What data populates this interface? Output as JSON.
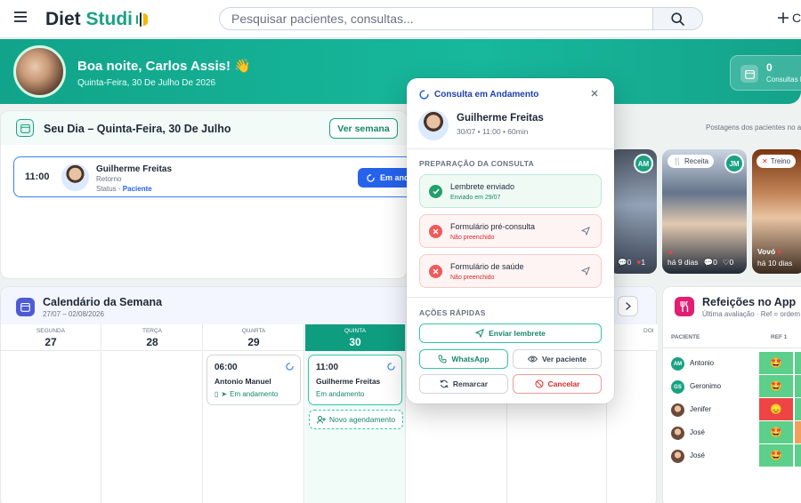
{
  "header": {
    "logo_main": "Diet ",
    "logo_accent": "Studi",
    "search_placeholder": "Pesquisar pacientes, consultas...",
    "plus_label": "C"
  },
  "hero": {
    "greeting": "Boa noite, Carlos Assis!",
    "wave": "👋",
    "date": "Quinta-Feira, 30 De Julho De 2026",
    "stat_value": "0",
    "stat_label": "Consultas H"
  },
  "day": {
    "title": "Seu Dia – Quinta-Feira, 30 De Julho",
    "week_button": "Ver semana",
    "appointment": {
      "time": "11:00",
      "name": "Guilherme Freitas",
      "type": "Retorno",
      "status_label": "Status - ",
      "status_value": "Paciente",
      "enter_button": "Em and"
    }
  },
  "posts": {
    "label": "Postagens dos pacientes no a",
    "stories": [
      {
        "badge": "",
        "avatar": "AM",
        "comments": "0",
        "likes": "1",
        "caption": "",
        "time": ""
      },
      {
        "badge": "Receita",
        "avatar": "JM",
        "comments": "0",
        "likes": "0",
        "caption": "",
        "time": "há 9 dias"
      },
      {
        "badge": "Treino",
        "avatar": "",
        "comments": "",
        "likes": "",
        "caption": "Vovó",
        "time": "há 10 dias"
      }
    ]
  },
  "calendar": {
    "title": "Calendário da Semana",
    "range": "27/07 – 02/08/2026",
    "days": [
      {
        "name": "SEGUNDA",
        "num": "27"
      },
      {
        "name": "TERÇA",
        "num": "28"
      },
      {
        "name": "QUARTA",
        "num": "29"
      },
      {
        "name": "QUINTA",
        "num": "30"
      },
      {
        "name": "",
        "num": ""
      },
      {
        "name": "",
        "num": ""
      },
      {
        "name": "DOI",
        "num": ""
      }
    ],
    "events": [
      {
        "time": "06:00",
        "name": "Antonio Manuel",
        "status": "Em andamento"
      },
      {
        "time": "11:00",
        "name": "Guilherme Freitas",
        "status": "Em andamento"
      }
    ],
    "new_appointment": "Novo agendamento"
  },
  "meals": {
    "title": "Refeições no App",
    "subtitle": "Última avaliação · Ref = ordem",
    "col_patient": "PACIENTE",
    "col_ref": "REF 1",
    "rows": [
      {
        "initials": "AM",
        "name": "Antonio",
        "emoji": "🤩",
        "color": "#5ccf8a"
      },
      {
        "initials": "GS",
        "name": "Geronimo",
        "emoji": "🤩",
        "color": "#5ccf8a"
      },
      {
        "initials": "",
        "name": "Jenifer",
        "emoji": "😞",
        "color": "#ef4444"
      },
      {
        "initials": "",
        "name": "José",
        "emoji": "🤩",
        "color": "#5ccf8a"
      },
      {
        "initials": "",
        "name": "José",
        "emoji": "🤩",
        "color": "#5ccf8a"
      }
    ]
  },
  "popup": {
    "title": "Consulta em Andamento",
    "patient": "Guilherme Freitas",
    "details": "30/07 • 11:00 • 60min",
    "prep_title": "PREPARAÇÃO DA CONSULTA",
    "prep": [
      {
        "title": "Lembrete enviado",
        "sub": "Enviado em 29/07"
      },
      {
        "title": "Formulário pré-consulta",
        "sub": "Não preenchido"
      },
      {
        "title": "Formulário de saúde",
        "sub": "Não preenchido"
      }
    ],
    "actions_title": "AÇÕES RÁPIDAS",
    "send_reminder": "Enviar lembrete",
    "whatsapp": "WhatsApp",
    "view_patient": "Ver paciente",
    "reschedule": "Remarcar",
    "cancel": "Cancelar"
  },
  "colors": {
    "brand": "#1aa283",
    "accent_blue": "#2563eb",
    "danger": "#dc2626"
  }
}
